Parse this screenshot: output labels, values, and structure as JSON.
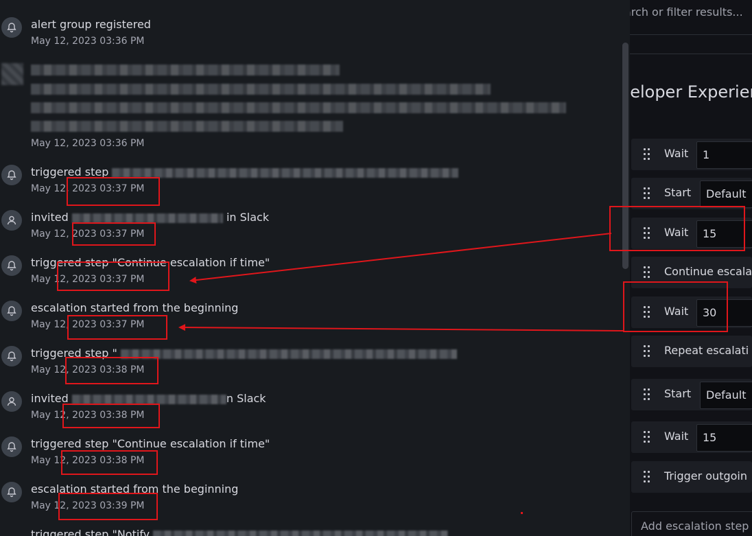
{
  "timeline": {
    "entries": [
      {
        "icon": "bell-icon",
        "title": "alert group registered",
        "time": "May 12, 2023 03:36 PM"
      },
      {
        "icon": "avatar-icon",
        "title": "",
        "time": "May 12, 2023 03:36 PM"
      },
      {
        "icon": "bell-icon",
        "title": "triggered step",
        "time": "May 12, 2023 03:37 PM"
      },
      {
        "icon": "user-icon",
        "title_prefix": "invited",
        "title_suffix": "in Slack",
        "time": "May 12, 2023 03:37 PM"
      },
      {
        "icon": "bell-icon",
        "title": "triggered step \"Continue escalation if time\"",
        "time": "May 12, 2023 03:37 PM"
      },
      {
        "icon": "bell-icon",
        "title": "escalation started from the beginning",
        "time": "May 12, 2023 03:37 PM"
      },
      {
        "icon": "bell-icon",
        "title": "triggered step \"",
        "time": "May 12, 2023 03:38 PM"
      },
      {
        "icon": "user-icon",
        "title_prefix": "invited",
        "title_suffix": "n Slack",
        "time": "May 12, 2023 03:38 PM"
      },
      {
        "icon": "bell-icon",
        "title": "triggered step \"Continue escalation if time\"",
        "time": "May 12, 2023 03:38 PM"
      },
      {
        "icon": "bell-icon",
        "title": "escalation started from the beginning",
        "time": "May 12, 2023 03:39 PM"
      },
      {
        "icon": "bell-icon",
        "title": "triggered step \"Notify",
        "time": ""
      }
    ]
  },
  "panel": {
    "search_placeholder": "arch or filter results...",
    "chain_name": "veloper Experien",
    "steps": [
      {
        "label": "Wait",
        "value": "1"
      },
      {
        "label": "Start",
        "value": "Default"
      },
      {
        "label": "Wait",
        "value": "15"
      },
      {
        "label": "Continue escala",
        "value": ""
      },
      {
        "label": "Wait",
        "value": "30"
      },
      {
        "label": "Repeat escalati",
        "value": ""
      },
      {
        "label": "Start",
        "value": "Default"
      },
      {
        "label": "Wait",
        "value": "15"
      },
      {
        "label": "Trigger outgoin",
        "value": ""
      }
    ],
    "add_step": "Add escalation step"
  },
  "colors": {
    "annotation": "#e0161b",
    "background": "#181b1f",
    "panel": "#111217"
  }
}
